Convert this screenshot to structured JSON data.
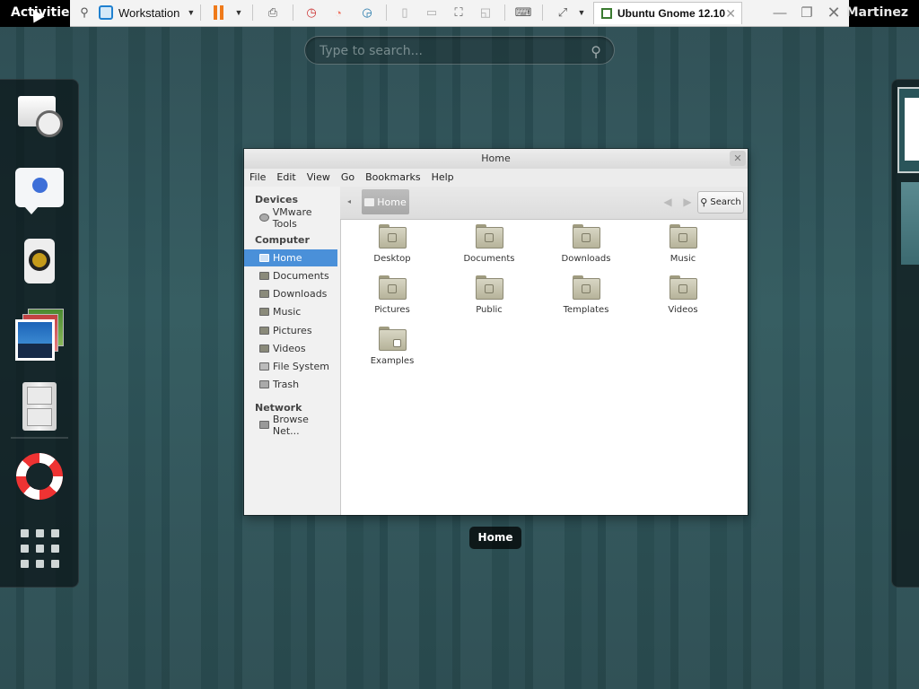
{
  "topbar": {
    "activities": "Activities",
    "user": "Martinez"
  },
  "vmware": {
    "vm_name": "Workstation",
    "tab_title": "Ubuntu Gnome 12.10",
    "tab_close": "✕",
    "minimize": "—",
    "restore": "❐",
    "close": "✕"
  },
  "overview": {
    "search_placeholder": "Type to search..."
  },
  "dash": {
    "items": [
      "evolution-icon",
      "empathy-chat-icon",
      "rhythmbox-speaker-icon",
      "shotwell-photos-icon",
      "file-cabinet-icon",
      "help-lifebuoy-icon"
    ],
    "apps_icon": "show-applications-grid-icon"
  },
  "window": {
    "title": "Home",
    "menu": [
      "File",
      "Edit",
      "View",
      "Go",
      "Bookmarks",
      "Help"
    ],
    "sidebar": {
      "devices_header": "Devices",
      "devices": [
        "VMware Tools"
      ],
      "computer_header": "Computer",
      "computer": [
        "Home",
        "Documents",
        "Downloads",
        "Music",
        "Pictures",
        "Videos",
        "File System",
        "Trash"
      ],
      "network_header": "Network",
      "network": [
        "Browse Net..."
      ],
      "selected": "Home"
    },
    "breadcrumb": "Home",
    "search_button": "Search",
    "files": [
      "Desktop",
      "Documents",
      "Downloads",
      "Music",
      "Pictures",
      "Public",
      "Templates",
      "Videos",
      "Examples"
    ]
  },
  "caption": "Home",
  "colors": {
    "selection": "#4a90d9",
    "pause": "#ef7a1a",
    "background": "#2f575c"
  }
}
